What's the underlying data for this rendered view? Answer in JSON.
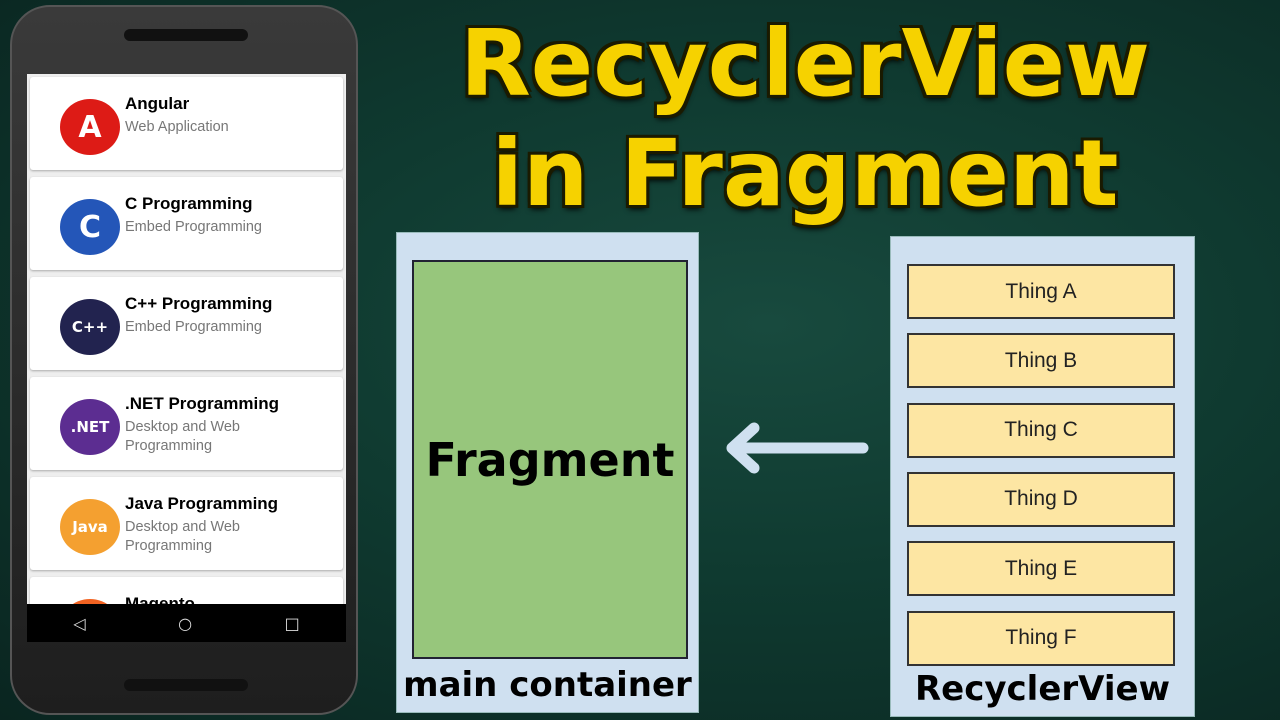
{
  "title": {
    "line1": "RecyclerView",
    "line2": "in Fragment"
  },
  "phone": {
    "items": [
      {
        "name": "Angular",
        "sub": "Web Application",
        "logo": "A",
        "color": "#dd1b16"
      },
      {
        "name": "C Programming",
        "sub": "Embed Programming",
        "logo": "C",
        "color": "#2456b8"
      },
      {
        "name": "C++ Programming",
        "sub": "Embed Programming",
        "logo": "C++",
        "color": "#22234f"
      },
      {
        "name": ".NET Programming",
        "sub": "Desktop and Web Programming",
        "logo": ".NET",
        "color": "#5c2d91"
      },
      {
        "name": "Java Programming",
        "sub": "Desktop and Web Programming",
        "logo": "Java",
        "color": "#f4a030"
      },
      {
        "name": "Magento",
        "sub": "",
        "logo": "",
        "color": "#f26322"
      }
    ],
    "nav": {
      "back": "◁",
      "home": "○",
      "recent": "□"
    }
  },
  "diagram": {
    "fragment": "Fragment",
    "main_container": "main container",
    "recyclerview": "RecyclerView",
    "things": [
      "Thing A",
      "Thing B",
      "Thing C",
      "Thing D",
      "Thing E",
      "Thing F"
    ],
    "colors": {
      "fragment": "#97c67c",
      "thing": "#fde6a3",
      "panel": "#cfe0f0",
      "title": "#f6d200"
    }
  }
}
